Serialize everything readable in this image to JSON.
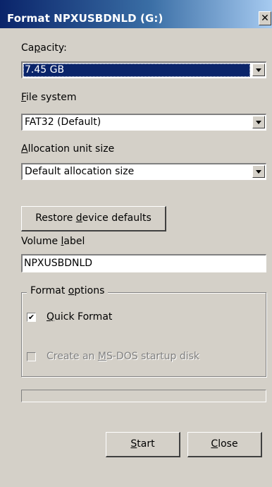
{
  "window": {
    "title": "Format NPXUSBDNLD (G:)",
    "close_glyph": "✕"
  },
  "capacity": {
    "label_pre": "Ca",
    "label_key": "p",
    "label_post": "acity:",
    "value": "7.45 GB"
  },
  "file_system": {
    "label_pre": "",
    "label_key": "F",
    "label_post": "ile system",
    "value": "FAT32 (Default)"
  },
  "allocation": {
    "label_pre": "",
    "label_key": "A",
    "label_post": "llocation unit size",
    "value": "Default allocation size"
  },
  "restore_button": {
    "pre": "Restore ",
    "key": "d",
    "post": "evice defaults"
  },
  "volume_label": {
    "label_pre": "Volume ",
    "label_key": "l",
    "label_post": "abel",
    "value": "NPXUSBDNLD"
  },
  "format_options": {
    "title_pre": "Format ",
    "title_key": "o",
    "title_post": "ptions",
    "quick_format": {
      "checked": true,
      "pre": "",
      "key": "Q",
      "post": "uick Format",
      "check_glyph": "✔"
    },
    "msdos_disk": {
      "checked": false,
      "enabled": false,
      "pre": "Create an ",
      "key": "M",
      "post": "S-DOS startup disk"
    }
  },
  "progress": {
    "value": 0
  },
  "buttons": {
    "start": {
      "pre": "",
      "key": "S",
      "post": "tart"
    },
    "close": {
      "pre": "",
      "key": "C",
      "post": "lose"
    }
  }
}
